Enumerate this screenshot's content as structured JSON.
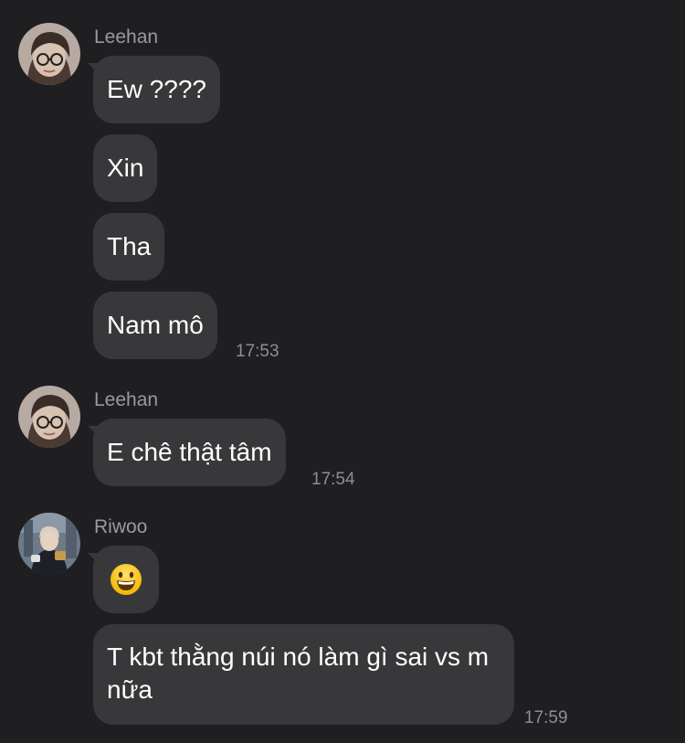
{
  "groups": [
    {
      "sender": "Leehan",
      "messages": [
        "Ew ????",
        "Xin",
        "Tha",
        "Nam mô"
      ],
      "time": "17:53"
    },
    {
      "sender": "Leehan",
      "messages": [
        "E chê thật tâm"
      ],
      "time": "17:54"
    },
    {
      "sender": "Riwoo",
      "emoji_icon": "grinning-face-emoji",
      "messages": [
        "T kbt thằng núi nó làm gì sai vs m nữa"
      ],
      "time": "17:59"
    }
  ],
  "colors": {
    "background": "#1f1f21",
    "bubble": "#38383b",
    "sender_text": "#9a9a9e",
    "time_text": "#8e8e93"
  }
}
